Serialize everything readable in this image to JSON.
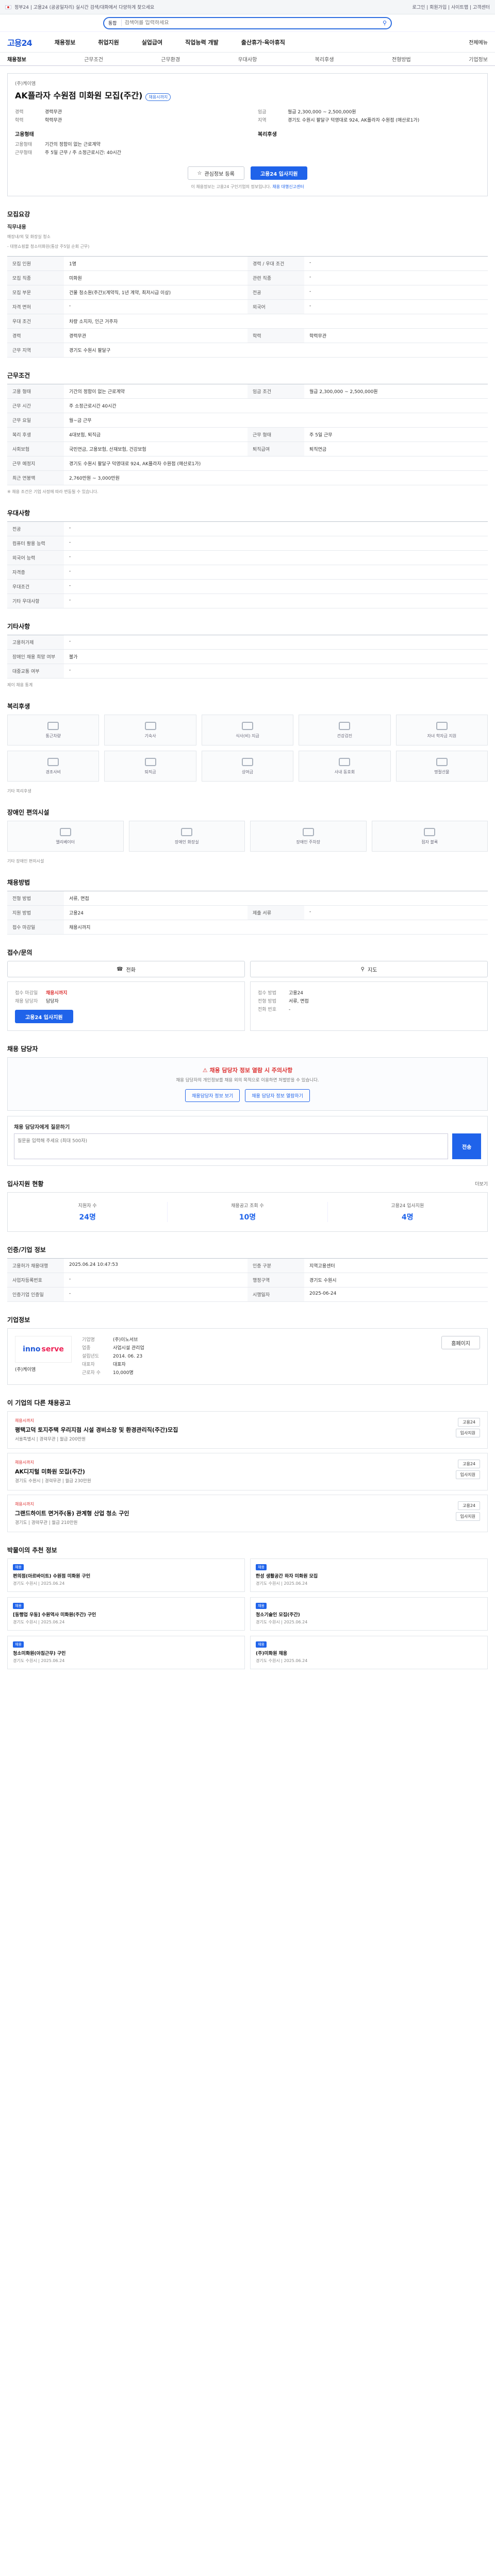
{
  "topbar": {
    "left": "정부24 | 고용24 (공공일자리) 실시간 검색/대화에서 다양하게 찾으세요",
    "right": "로그인 | 회원가입 | 사이트맵 | 고객센터"
  },
  "search": {
    "category": "통합",
    "placeholder": "검색어를 입력하세요"
  },
  "nav": {
    "logo": "고용24",
    "items": [
      "채용정보",
      "취업지원",
      "실업급여",
      "직업능력 개발",
      "출산휴가·육아휴직"
    ],
    "right": "전체메뉴"
  },
  "tabs": [
    "채용정보",
    "근무조건",
    "근무환경",
    "우대사항",
    "복리후생",
    "전형방법",
    "기업정보"
  ],
  "job": {
    "company": "(주)케이엠",
    "title": "AK플라자 수원점 미화원 모집(주간)",
    "badge": "채용시까지",
    "left": [
      {
        "k": "경력",
        "v": "경력무관"
      },
      {
        "k": "학력",
        "v": "학력무관"
      }
    ],
    "right": [
      {
        "k": "임금",
        "v": "월급 2,300,000 ~ 2,500,000원"
      },
      {
        "k": "지역",
        "v": "경기도 수원시 팔달구 덕영대로 924, AK플라자 수원점 (매산로1가)"
      }
    ],
    "etype_h": "고용형태",
    "etype_l": [
      {
        "k": "고용형태",
        "v": "기간의 정함이 없는 근로계약"
      },
      {
        "k": "근무형태",
        "v": "주 5일 근무 / 주 소정근로시간: 40시간"
      }
    ],
    "welfare_h": "복리후생",
    "bookmark": "관심정보 등록",
    "apply": "고용24 입사지원",
    "note": "이 채용정보는 고용24 구인기업의 정보입니다.",
    "note_link": "채용 대행신고센터"
  },
  "sec1": {
    "h": "모집요강",
    "duty_h": "직무내용",
    "duty": "매장내/외 및 화장실 청소",
    "duty2": "- 대형쇼핑몰 청소미화원(통상 주5일 순회 근무)",
    "rows": [
      [
        "모집 인원",
        "1명",
        "경력 / 우대 조건",
        "-"
      ],
      [
        "모집 직종",
        "미화원",
        "관련 직종",
        "-"
      ],
      [
        "모집 부문",
        "건물 청소원(주간)(계약직, 1년 계약, 최저시급 이상)",
        "전공",
        "-"
      ],
      [
        "자격 면허",
        "-",
        "외국어",
        "-"
      ],
      [
        "우대 조건",
        "차량 소지자, 인근 거주자",
        "",
        ""
      ],
      [
        "경력",
        "경력무관",
        "학력",
        "학력무관"
      ],
      [
        "근무 지역",
        "경기도 수원시 팔달구",
        "",
        ""
      ]
    ]
  },
  "sec2": {
    "h": "근무조건",
    "rows": [
      [
        "고용 형태",
        "기간의 정함이 없는 근로계약",
        "임금 조건",
        "월급 2,300,000 ~ 2,500,000원"
      ],
      [
        "근무 시간",
        "주 소정근로시간 40시간",
        "",
        ""
      ],
      [
        "근무 요일",
        "월~금 근무",
        "",
        ""
      ],
      [
        "복리 후생",
        "4대보험, 퇴직금",
        "근무 형태",
        "주 5일 근무"
      ],
      [
        "사회보험",
        "국민연금, 고용보험, 산재보험, 건강보험",
        "퇴직급여",
        "퇴직연금"
      ],
      [
        "근무 예정지",
        "경기도 수원시 팔달구 덕영대로 924, AK플라자 수원점 (매산로1가)",
        "",
        ""
      ],
      [
        "최근 연봉액",
        "2,760만원 ~ 3,000만원",
        "",
        ""
      ]
    ],
    "note": "※ 채용 조건은 기업 사정에 따라 변동될 수 있습니다."
  },
  "sec3": {
    "h": "우대사항",
    "rows": [
      [
        "전공",
        "-"
      ],
      [
        "컴퓨터 활용 능력",
        "-"
      ],
      [
        "외국어 능력",
        "-"
      ],
      [
        "자격증",
        "-"
      ],
      [
        "우대조건",
        "-"
      ],
      [
        "기타 우대사항",
        "-"
      ]
    ]
  },
  "sec4": {
    "h": "기타사항",
    "rows": [
      [
        "고용허가제",
        "-"
      ],
      [
        "장애인 채용 희망 여부",
        "불가"
      ],
      [
        "대중교통 여부",
        "-"
      ]
    ],
    "link": "제이 채용 통계"
  },
  "sec5": {
    "h": "복리후생",
    "items": [
      "통근차량",
      "기숙사",
      "식사(비) 지급",
      "건강검진",
      "자녀 학자금 지원",
      "경조사비",
      "퇴직금",
      "상여금",
      "사내 동호회",
      "명절선물"
    ],
    "more": "기타 복리후생"
  },
  "sec6": {
    "h": "장애인 편의시설",
    "items": [
      "엘리베이터",
      "장애인 화장실",
      "장애인 주차장",
      "점자 블록"
    ],
    "more": "기타 장애인 편의시설"
  },
  "sec7": {
    "h": "채용방법",
    "rows": [
      [
        "전형 방법",
        "서류, 면접",
        "",
        ""
      ],
      [
        "지원 방법",
        "고용24",
        "제출 서류",
        "-"
      ],
      [
        "접수 마감일",
        "채용시까지",
        "",
        ""
      ]
    ]
  },
  "sec8": {
    "h": "접수/문의",
    "btn_call": "전화",
    "btn_map": "지도",
    "left": [
      {
        "k": "접수 마감일",
        "v": "채용시까지"
      },
      {
        "k": "채용 담당자",
        "v": "담당자"
      }
    ],
    "apply": "고용24 입사지원",
    "right": [
      {
        "k": "접수 방법",
        "v": "고용24"
      },
      {
        "k": "전형 방법",
        "v": "서류, 면접"
      },
      {
        "k": "전화 번호",
        "v": "-"
      }
    ]
  },
  "sec9": {
    "h": "채용 담당자",
    "warn": "채용 담당자 정보 열람 시 주의사항",
    "warn_p": "채용 담당자의 개인정보를 채용 외의 목적으로 이용하면 처벌받을 수 있습니다.",
    "b1": "채용담당자 정보 보기",
    "b2": "채용 담당자 정보 열람하기",
    "qa": "채용 담당자에게 질문하기",
    "send": "전송",
    "qa_ph": "질문을 입력해 주세요 (최대 500자)"
  },
  "sec10": {
    "h": "입사지원 현황",
    "more": "더보기",
    "stats": [
      {
        "k": "지원자 수",
        "v": "24명"
      },
      {
        "k": "채용공고 조회 수",
        "v": "10명"
      },
      {
        "k": "고용24 입사지원",
        "v": "4명"
      }
    ]
  },
  "sec11": {
    "h": "인증/기업 정보",
    "rows": [
      [
        "고용허가 채용대행",
        "2025.06.24 10:47:53",
        "인증 구분",
        "지역고용센터"
      ],
      [
        "사업자등록번호",
        "-",
        "행정구역",
        "경기도 수원시"
      ],
      [
        "인증기업 인증일",
        "-",
        "시행일자",
        "2025-06-24"
      ]
    ]
  },
  "sec12": {
    "h": "기업정보",
    "logo_a": "inno",
    "logo_b": "serve",
    "name": "(주)케이엠",
    "rows": [
      {
        "k": "기업명",
        "v": "(주)이노서브"
      },
      {
        "k": "업종",
        "v": "사업시설 관리업"
      },
      {
        "k": "설립년도",
        "v": "2014. 06. 23"
      },
      {
        "k": "대표자",
        "v": "대표자"
      },
      {
        "k": "근로자 수",
        "v": "10,000명"
      }
    ],
    "homepage": "홈페이지"
  },
  "sec13": {
    "h": "이 기업의 다른 채용공고",
    "jobs": [
      {
        "tag": "채용시까지",
        "title": "평택고덕 토지주택 우리지점 시설 경비소장 및 환경관리직(주간)모집",
        "meta": "서울특별시 | 경력무관 | 월급 200만원",
        "chips": [
          "고용24",
          "입사지원"
        ]
      },
      {
        "tag": "채용시까지",
        "title": "AK디지털 미화원 모집(주간)",
        "meta": "경기도 수원시 | 경력무관 | 월급 230만원",
        "chips": [
          "고용24",
          "입사지원"
        ]
      },
      {
        "tag": "채용시까지",
        "title": "그랜드하이트 면거주(동) 관계형 산업 청소 구인",
        "meta": "경기도 | 경력무관 | 월급 210만원",
        "chips": [
          "고용24",
          "입사지원"
        ]
      }
    ]
  },
  "sec14": {
    "h": "박물이의 추천 정보",
    "items": [
      {
        "b": "채용",
        "t": "편의점(아르바이트) 수원점 미화원 구인",
        "m": "경기도 수원시 | 2025.06.24"
      },
      {
        "b": "채용",
        "t": "한성 생활공간 하자 미화원 모집",
        "m": "경기도 수원시 | 2025.06.24"
      },
      {
        "b": "채용",
        "t": "[동행업 우동] 수원역사 미화원(주간) 구인",
        "m": "경기도 수원시 | 2025.06.24"
      },
      {
        "b": "채용",
        "t": "청소기술인 모집(주간)",
        "m": "경기도 수원시 | 2025.06.24"
      },
      {
        "b": "채용",
        "t": "청소미화원(아침근무) 구인",
        "m": "경기도 수원시 | 2025.06.24"
      },
      {
        "b": "채용",
        "t": "(주)미화원 채용",
        "m": "경기도 수원시 | 2025.06.24"
      }
    ]
  }
}
